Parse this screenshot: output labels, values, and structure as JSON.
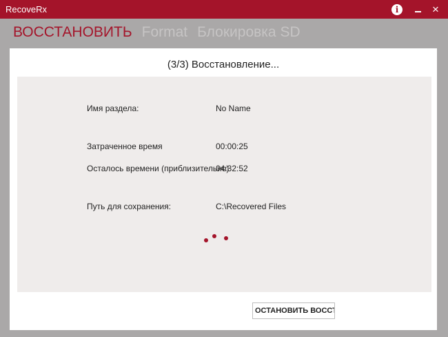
{
  "window": {
    "title": "RecoveRx",
    "accent_color": "#a4142a",
    "close_symbol": "×"
  },
  "icons": {
    "info": "info-icon",
    "minimize": "minimize-icon",
    "close": "close-icon"
  },
  "tabs": [
    {
      "label": "ВОССТАНОВИТЬ",
      "active": true
    },
    {
      "label": "Format",
      "active": false
    },
    {
      "label": "Блокировка SD",
      "active": false
    }
  ],
  "progress": {
    "title": "(3/3) Восстановление...",
    "rows": [
      {
        "label": "Имя раздела:",
        "value": "No Name"
      },
      {
        "label": "Затраченное время",
        "value": "00:00:25"
      },
      {
        "label": "Осталось времени (приблизительно)",
        "value": "04:32:52"
      },
      {
        "label": "Путь для сохранения:",
        "value": "C:\\Recovered Files"
      }
    ],
    "spinner": "loading-spinner"
  },
  "buttons": {
    "stop_label": "ОСТАНОВИТЬ ВОССТАНОВЛЕНИЕ"
  }
}
